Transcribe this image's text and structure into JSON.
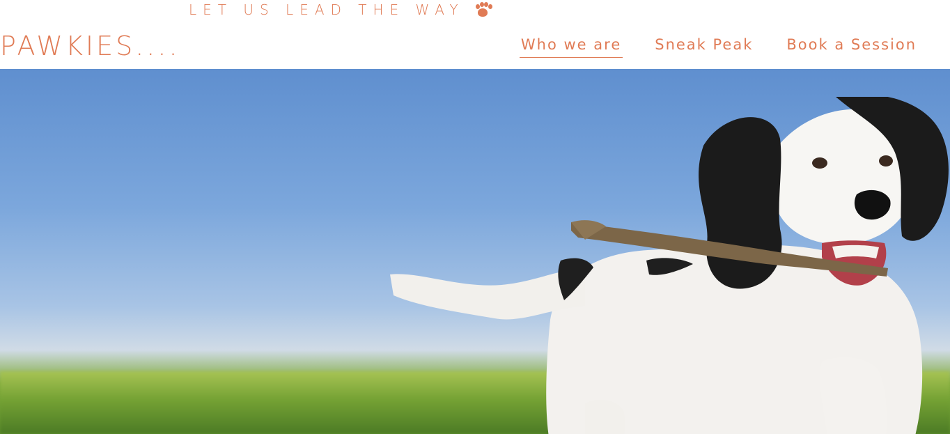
{
  "header": {
    "tagline": "LET US LEAD THE WAY",
    "tagline_icon": "paw-icon",
    "logo": "PAWKIES....",
    "accent_color": "#e07b55"
  },
  "nav": {
    "items": [
      {
        "label": "Who we are",
        "active": true
      },
      {
        "label": "Sneak Peak",
        "active": false
      },
      {
        "label": "Book a Session",
        "active": false
      }
    ]
  },
  "hero": {
    "image": "dog-running-with-stick"
  }
}
